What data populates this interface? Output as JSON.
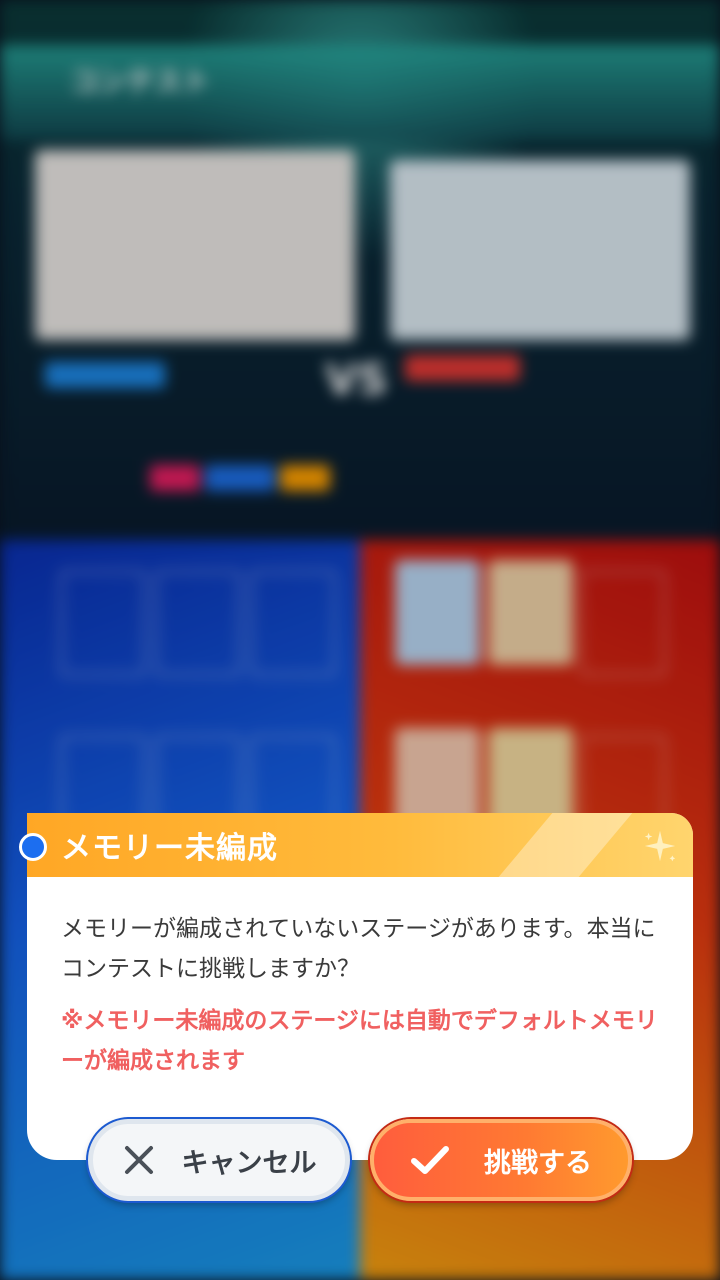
{
  "background": {
    "header_title": "コンテスト",
    "vs_label": "VS"
  },
  "dialog": {
    "title": "メモリー未編成",
    "message": "メモリーが編成されていないステージがあります。本当にコンテストに挑戦しますか？",
    "note": "※メモリー未編成のステージには自動でデフォルトメモリーが編成されます",
    "header_color": "#ffa725",
    "note_color": "#f06060"
  },
  "buttons": {
    "cancel_label": "キャンセル",
    "confirm_label": "挑戦する",
    "confirm_color": "#ff6a35"
  },
  "icons": {
    "cancel": "close-icon",
    "confirm": "checkmark-icon",
    "header": "sparkle-icon"
  }
}
